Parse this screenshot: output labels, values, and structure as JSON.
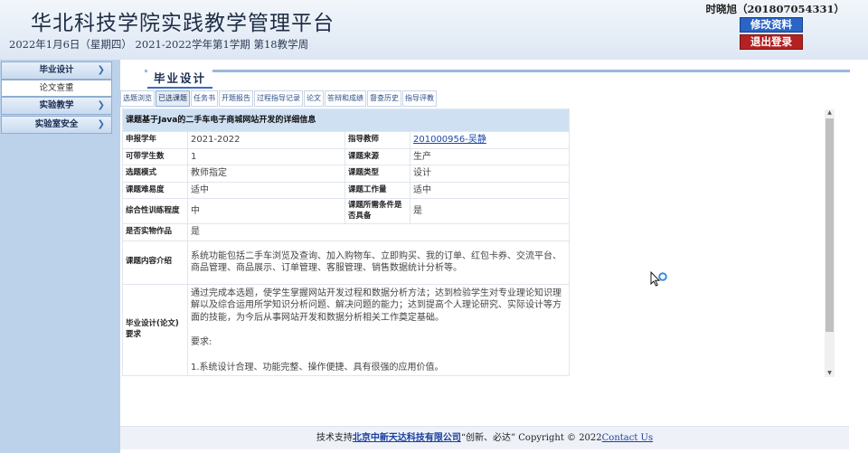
{
  "header": {
    "title": "华北科技学院实践教学管理平台",
    "date_line": "2022年1月6日（星期四） 2021-2022学年第1学期 第18教学周",
    "user": "时晓旭（201807054331）",
    "edit_label": "修改资料",
    "logout_label": "退出登录"
  },
  "sidebar": {
    "items": [
      {
        "label": "毕业设计"
      },
      {
        "label": "论文查重"
      },
      {
        "label": "实验教学"
      },
      {
        "label": "实验室安全"
      }
    ]
  },
  "section": {
    "title": "毕业设计"
  },
  "tabs": [
    "选题浏览",
    "已选课题",
    "任务书",
    "开题报告",
    "过程指导记录",
    "论文",
    "答辩和成绩",
    "督查历史",
    "指导评教"
  ],
  "detail": {
    "caption": "课题基于Java的二手车电子商城网站开发的详细信息",
    "rows": [
      {
        "l1": "申报学年",
        "v1": "2021-2022",
        "l2": "指导教师",
        "v2": "201000956-吴静"
      },
      {
        "l1": "可带学生数",
        "v1": "1",
        "l2": "课题来源",
        "v2": "生产"
      },
      {
        "l1": "选题模式",
        "v1": "教师指定",
        "l2": "课题类型",
        "v2": "设计"
      },
      {
        "l1": "课题难易度",
        "v1": "适中",
        "l2": "课题工作量",
        "v2": "适中"
      },
      {
        "l1": "综合性训练程度",
        "v1": "中",
        "l2": "课题所需条件是否具备",
        "v2": "是"
      }
    ],
    "practical_label": "是否实物作品",
    "practical_value": "是",
    "content_label": "课题内容介绍",
    "content_value": "系统功能包括二手车浏览及查询、加入购物车、立即购买、我的订单、红包卡券、交流平台、商品管理、商品展示、订单管理、客服管理、销售数据统计分析等。",
    "req_label": "毕业设计(论文)要求",
    "req_para1": "通过完成本选题，使学生掌握网站开发过程和数据分析方法；达到检验学生对专业理论知识理解以及综合运用所学知识分析问题、解决问题的能力；达到提高个人理论研究、实际设计等方面的技能，为今后从事网站开发和数据分析相关工作奠定基础。",
    "req_para2": "要求:",
    "req_para3": "1.系统设计合理、功能完整、操作便捷、具有很强的应用价值。"
  },
  "footer": {
    "prefix": "技术支持",
    "company": "北京中新天达科技有限公司",
    "slogan": "“创新、必达” Copyright © 2022",
    "contact": "Contact Us"
  },
  "colors": {
    "accent": "#2a64c4",
    "danger": "#b32222",
    "sidebar_bg": "#bcd2ea",
    "caption_bg": "#cfe0f3"
  }
}
